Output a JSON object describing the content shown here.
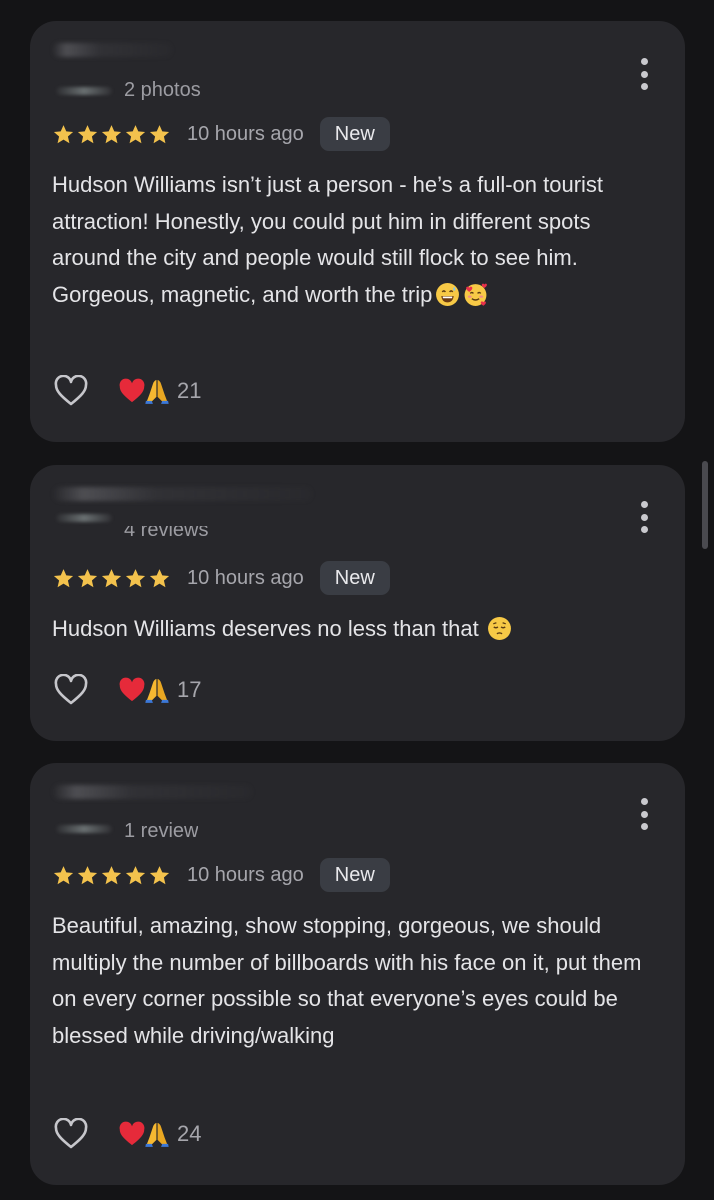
{
  "colors": {
    "background": "#141416",
    "card": "#27272b",
    "star": "#f3c24d",
    "badge": "#3a3d44"
  },
  "reviews": [
    {
      "meta": "2 photos",
      "stars": 5,
      "time": "10 hours ago",
      "badge": "New",
      "text": "Hudson Williams isn’t just a person - he’s a full-on tourist attraction! Honestly, you could put him in different spots around the city and people would still flock to see him. Gorgeous, magnetic, and worth the trip",
      "emojis": [
        "grinning-sweat-emoji",
        "smiling-face-with-hearts-emoji"
      ],
      "reaction_count": "21"
    },
    {
      "meta": "4 reviews",
      "stars": 5,
      "time": "10 hours ago",
      "badge": "New",
      "text": "Hudson Williams deserves no less than that",
      "emojis": [
        "pensive-face-emoji"
      ],
      "reaction_count": "17"
    },
    {
      "meta": "1 review",
      "stars": 5,
      "time": "10 hours ago",
      "badge": "New",
      "text": "Beautiful, amazing, show stopping, gorgeous, we should multiply the number of billboards with his face on it, put them on every corner possible so that everyone’s eyes could be blessed while driving/walking",
      "emojis": [],
      "reaction_count": "24"
    }
  ],
  "icons": {
    "like": "heart-outline-icon",
    "more": "more-vertical-icon",
    "reactions": [
      "red-heart-emoji",
      "folded-hands-emoji"
    ]
  }
}
